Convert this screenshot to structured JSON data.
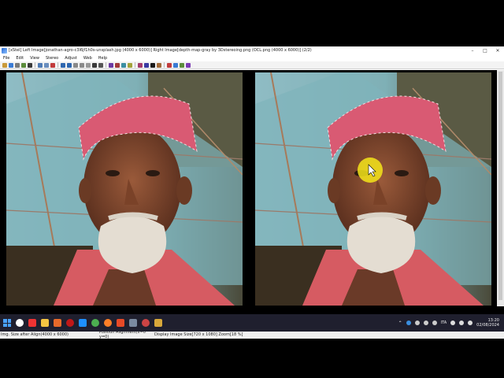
{
  "window": {
    "title": "[xStel] Left Image[jonathan-agro-c3l6jf1h0s-unsplash.jpg (4000 x 6000)] Right Image[depth-map-gray by 3Dstereoing.png (OCL.png (4000 x 6000)] (2/2)",
    "minimize_glyph": "–",
    "maximize_glyph": "□",
    "close_glyph": "✕"
  },
  "menu": [
    "File",
    "Edit",
    "View",
    "Stereo",
    "Adjust",
    "Web",
    "Help"
  ],
  "status": {
    "img_size": "Img. Size after Align(4000 x 6000)",
    "position": "Position Alignment(x=0 y=0)",
    "display": "Display Image Size[720 x 1080]  Zoom[18 %]"
  },
  "tray": {
    "lang": "ITA",
    "time": "13:20",
    "date": "02/08/2024"
  },
  "colors": {
    "taskbar": "#1f1f2e",
    "highlight_cursor": "#f5e51a"
  }
}
